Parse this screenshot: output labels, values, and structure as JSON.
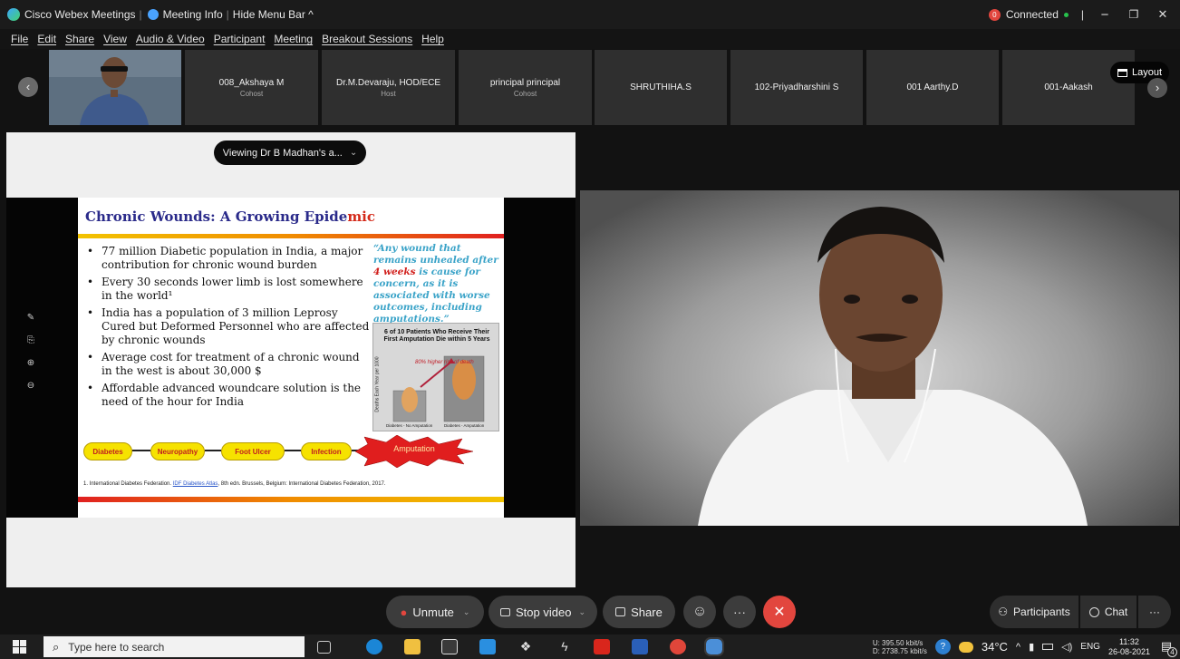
{
  "titlebar": {
    "app_name": "Cisco Webex Meetings",
    "sep1": "|",
    "meeting_info": "Meeting Info",
    "sep2": "|",
    "hide_menu": "Hide Menu Bar ^",
    "rec_count": "0",
    "connected": "Connected",
    "tb_sep": "|",
    "minimize": "−",
    "restore": "❐",
    "close": "✕"
  },
  "menu": [
    "File",
    "Edit",
    "Share",
    "View",
    "Audio & Video",
    "Participant",
    "Meeting",
    "Breakout Sessions",
    "Help"
  ],
  "strip": {
    "prev": "‹",
    "next": "›",
    "layout_label": "Layout",
    "participants": [
      {
        "name": "008_Akshaya M",
        "role": "Cohost"
      },
      {
        "name": "Dr.M.Devaraju, HOD/ECE",
        "role": "Host"
      },
      {
        "name": "principal principal",
        "role": "Cohost"
      },
      {
        "name": "SHRUTHIHA.S",
        "role": ""
      },
      {
        "name": "102-Priyadharshini S",
        "role": ""
      },
      {
        "name": "001 Aarthy.D",
        "role": ""
      },
      {
        "name": "001-Aakash",
        "role": ""
      }
    ]
  },
  "share": {
    "viewing_label": "Viewing Dr B Madhan's a...",
    "viewing_chevron": "⌄"
  },
  "slide": {
    "title_main": "Chronic Wounds: A Growing Epide",
    "title_tail": "mic",
    "bullets": [
      "77 million Diabetic population in India, a major contribution for chronic wound burden",
      "Every 30 seconds lower limb is lost somewhere in the world¹",
      "India has a population of 3 million Leprosy Cured but Deformed Personnel who are affected by chronic wounds",
      "Average cost for treatment of a chronic wound in the west is about 30,000 $",
      "Affordable advanced woundcare solution is the need of the hour for India"
    ],
    "quote_a": "“Any wound that remains unhealed after ",
    "quote_hl": "4 weeks",
    "quote_b": " is cause for concern, as it is associated with worse outcomes, including amputations.”",
    "inset_title": "6 of 10 Patients Who Receive Their First Amputation Die within 5 Years",
    "inset_note": "80% higher risk of death",
    "inset_ylabel": "Deaths Each Year per 1000",
    "inset_x1": "Diabetes - No Amputation",
    "inset_x2": "Diabetes - Amputation",
    "flow": [
      "Diabetes",
      "Neuropathy",
      "Foot Ulcer",
      "Infection",
      "Amputation"
    ],
    "ref_a": "1. International Diabetes Federation. ",
    "ref_link": "IDF Diabetes Atlas",
    "ref_b": ", 8th edn. Brussels, Belgium: International Diabetes Federation, 2017."
  },
  "controls": {
    "unmute": "Unmute",
    "stop_video": "Stop video",
    "share": "Share",
    "reactions": "☺",
    "more": "···",
    "leave": "✕",
    "participants": "Participants",
    "chat": "Chat",
    "overflow": "···"
  },
  "taskbar": {
    "search_placeholder": "Type here to search",
    "upload": "U:  395.50 kbit/s",
    "download": "D:  2738.75 kbit/s",
    "temperature": "34°C",
    "language": "ENG",
    "time": "11:32",
    "date": "26-08-2021",
    "notif_count": "4"
  },
  "colors": {
    "leave_red": "#e2463e",
    "slide_title_blue": "#2a2a8a",
    "quote_teal": "#3aa3c8"
  }
}
